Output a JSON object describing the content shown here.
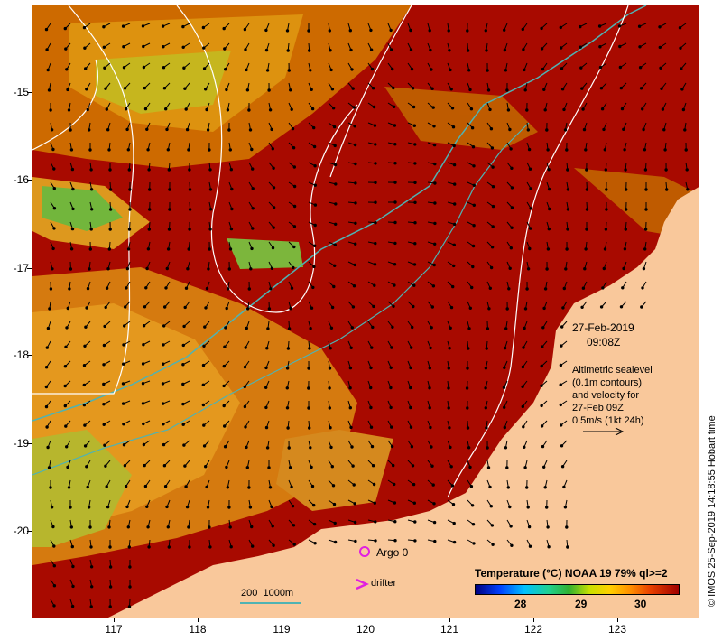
{
  "map": {
    "y_ticks": [
      "-15",
      "-16",
      "-17",
      "-18",
      "-19",
      "-20"
    ],
    "x_ticks": [
      "117",
      "118",
      "119",
      "120",
      "121",
      "122",
      "123"
    ]
  },
  "annotation": {
    "date": "27-Feb-2019",
    "time": "09:08Z",
    "desc_lines": [
      "Altimetric sealevel",
      "(0.1m contours)",
      "and velocity for",
      "27-Feb 09Z",
      "0.5m/s (1kt 24h)"
    ]
  },
  "legend": {
    "argo_label": "Argo 0",
    "drifter_label": "drifter",
    "scale_label": "200  1000m",
    "colorbar_title": "Temperature (°C) NOAA 19 79% ql>=2",
    "colorbar_ticks": [
      "28",
      "29",
      "30"
    ]
  },
  "credit": "© IMOS 25-Sep-2019 14:18:55 Hobart time",
  "colors": {
    "ocean_warm": "#a80a00",
    "land": "#f9c89b",
    "isobath": "#4fb3b3",
    "contour": "#ffffff",
    "argo": "#e020e0"
  }
}
